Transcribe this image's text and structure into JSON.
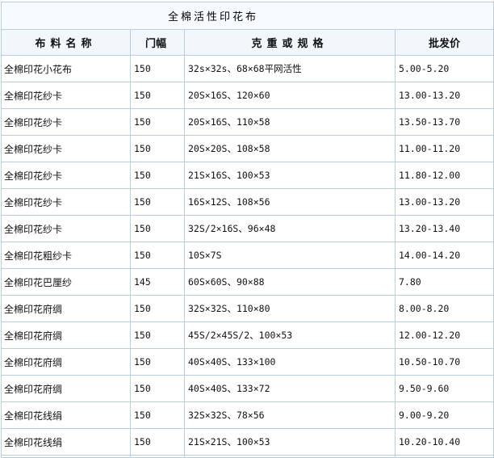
{
  "title": "全棉活性印花布",
  "headers": {
    "name": "布料名称",
    "width": "门幅",
    "spec": "克重或规格",
    "price": "批发价"
  },
  "rows": [
    {
      "name": "全棉印花小花布",
      "width": "150",
      "spec": "32s×32s、68×68平网活性",
      "price": "5.00-5.20"
    },
    {
      "name": "全棉印花纱卡",
      "width": "150",
      "spec": "20S×16S、120×60",
      "price": "13.00-13.20"
    },
    {
      "name": "全棉印花纱卡",
      "width": "150",
      "spec": "20S×16S、110×58",
      "price": "13.50-13.70"
    },
    {
      "name": "全棉印花纱卡",
      "width": "150",
      "spec": "20S×20S、108×58",
      "price": "11.00-11.20"
    },
    {
      "name": "全棉印花纱卡",
      "width": "150",
      "spec": "21S×16S、100×53",
      "price": "11.80-12.00"
    },
    {
      "name": "全棉印花纱卡",
      "width": "150",
      "spec": "16S×12S、108×56",
      "price": "13.00-13.20"
    },
    {
      "name": "全棉印花纱卡",
      "width": "150",
      "spec": "32S/2×16S、96×48",
      "price": "13.20-13.40"
    },
    {
      "name": "全棉印花粗纱卡",
      "width": "150",
      "spec": "10S×7S",
      "price": "14.00-14.20"
    },
    {
      "name": "全棉印花巴厘纱",
      "width": "145",
      "spec": "60S×60S、90×88",
      "price": "7.80"
    },
    {
      "name": "全棉印花府绸",
      "width": "150",
      "spec": "32S×32S、110×80",
      "price": "8.00-8.20"
    },
    {
      "name": "全棉印花府绸",
      "width": "150",
      "spec": "45S/2×45S/2、100×53",
      "price": "12.00-12.20"
    },
    {
      "name": "全棉印花府绸",
      "width": "150",
      "spec": "40S×40S、133×100",
      "price": "10.50-10.70"
    },
    {
      "name": "全棉印花府绸",
      "width": "150",
      "spec": "40S×40S、133×72",
      "price": "9.50-9.60"
    },
    {
      "name": "全棉印花线绢",
      "width": "150",
      "spec": "32S×32S、78×56",
      "price": "9.00-9.20"
    },
    {
      "name": "全棉印花线绢",
      "width": "150",
      "spec": "21S×21S、100×53",
      "price": "10.20-10.40"
    }
  ],
  "colors": {
    "border": "#b7cde0",
    "header_bg": "#f2f7fc",
    "title_bg": "#f7fbff"
  }
}
